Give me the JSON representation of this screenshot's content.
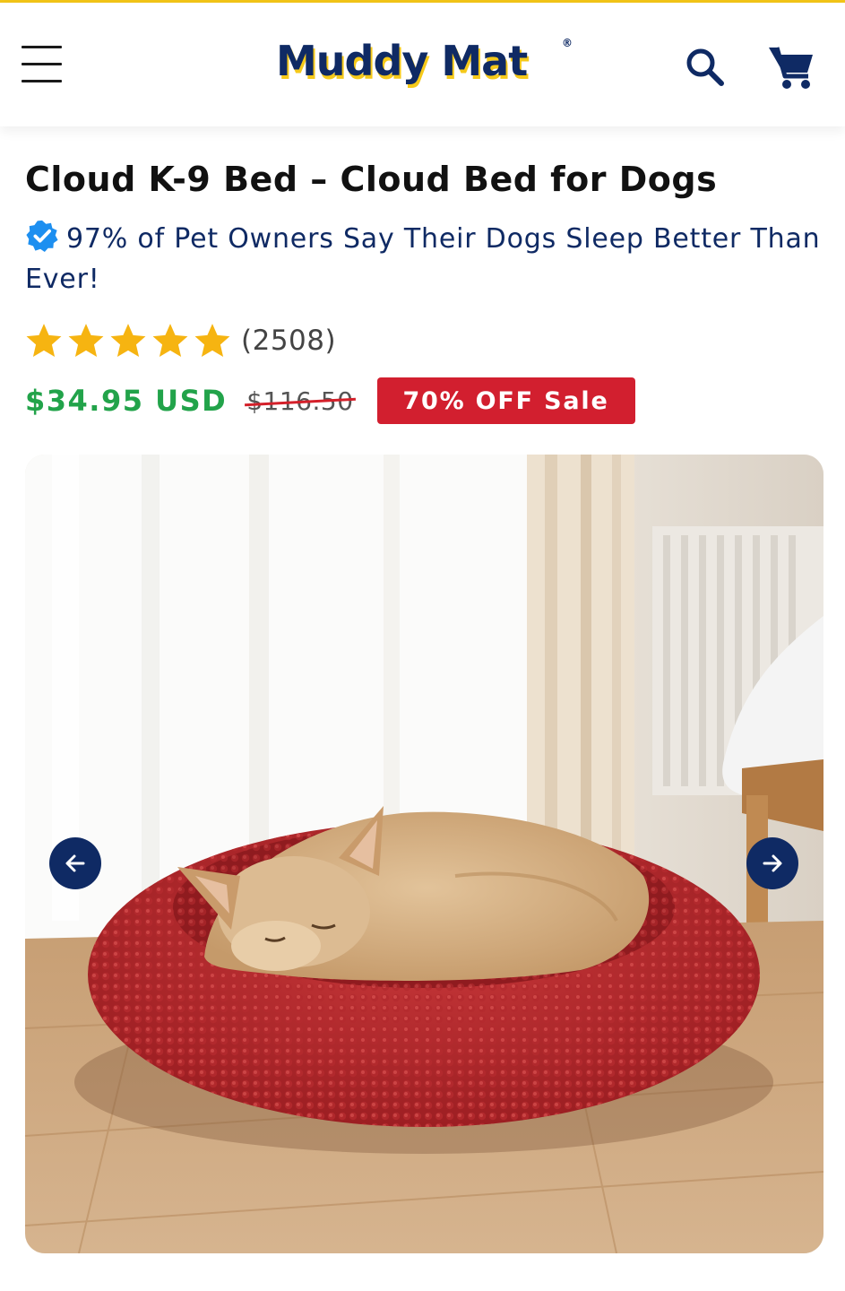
{
  "header": {
    "menu_icon": "hamburger-menu-icon",
    "logo_text": "Muddy Mat",
    "logo_mark": "®",
    "search_icon": "search-icon",
    "cart_icon": "cart-icon",
    "accent_color": "#f2c418",
    "brand_color": "#0f2a64"
  },
  "product": {
    "title": "Cloud K-9 Bed – Cloud Bed for Dogs",
    "tagline": "97% of Pet Owners Say Their Dogs Sleep Better Than Ever!",
    "verified_icon": "verified-badge-icon",
    "rating": 5,
    "rating_max": 5,
    "review_count": "(2508)",
    "price": "$34.95 USD",
    "compare_price": "$116.50",
    "sale_badge": "70% OFF Sale",
    "price_color": "#22a34a",
    "sale_color": "#d21f2f"
  },
  "gallery": {
    "image_alt": "dog sleeping in red cloud bed",
    "prev_icon": "arrow-left-icon",
    "next_icon": "arrow-right-icon"
  }
}
